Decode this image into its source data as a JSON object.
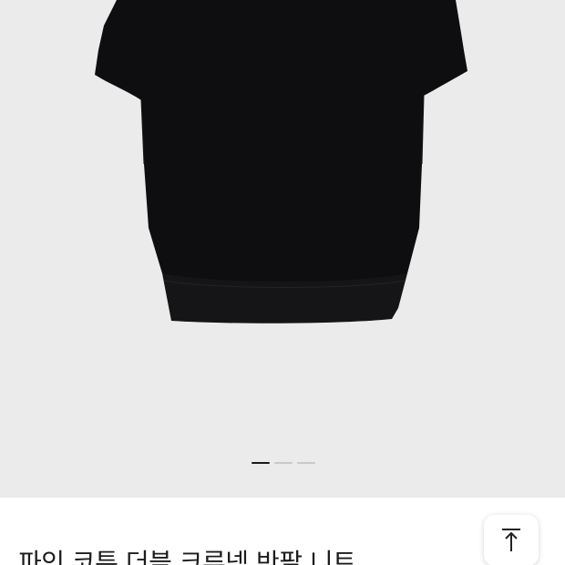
{
  "product": {
    "title": "파인 코튼 더블 크루넥 반팔 니트",
    "image_icon": "knit-shirt-photo",
    "garment_color": "#0d0d0f"
  },
  "gallery": {
    "slide_count": 3,
    "active_index": 0
  },
  "actions": {
    "scroll_top_icon": "arrow-up-to-top-icon"
  }
}
